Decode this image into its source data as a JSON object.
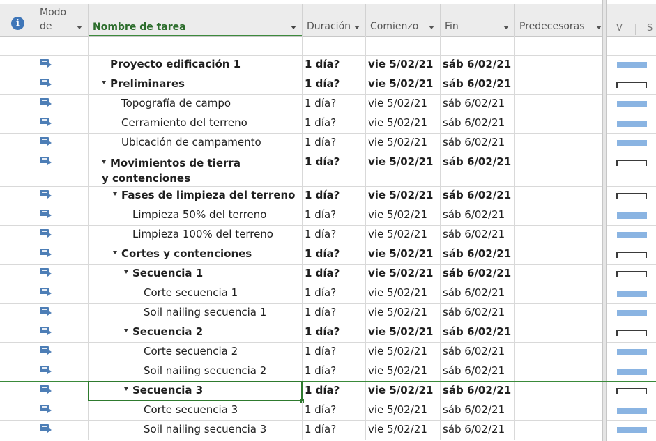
{
  "header": {
    "info": "i",
    "modo_line1": "Modo",
    "modo_line2": "de",
    "name": "Nombre de tarea",
    "duration": "Duración",
    "start": "Comienzo",
    "end": "Fin",
    "predecessors": "Predecesoras",
    "timescale_v": "V",
    "timescale_s": "S"
  },
  "tasks": [
    {
      "name": "Proyecto edificación 1",
      "duration": "1 día?",
      "start": "vie 5/02/21",
      "end": "sáb 6/02/21",
      "summary": false,
      "bold": true,
      "level": 0,
      "bar": "bar"
    },
    {
      "name": "Preliminares",
      "duration": "1 día?",
      "start": "vie 5/02/21",
      "end": "sáb 6/02/21",
      "summary": true,
      "bold": true,
      "level": 0,
      "bar": "summary"
    },
    {
      "name": "Topografía de campo",
      "duration": "1 día?",
      "start": "vie 5/02/21",
      "end": "sáb 6/02/21",
      "summary": false,
      "bold": false,
      "level": 1,
      "bar": "bar"
    },
    {
      "name": "Cerramiento del terreno",
      "duration": "1 día?",
      "start": "vie 5/02/21",
      "end": "sáb 6/02/21",
      "summary": false,
      "bold": false,
      "level": 1,
      "bar": "bar"
    },
    {
      "name": "Ubicación de campamento",
      "duration": "1 día?",
      "start": "vie 5/02/21",
      "end": "sáb 6/02/21",
      "summary": false,
      "bold": false,
      "level": 1,
      "bar": "bar"
    },
    {
      "name": "Movimientos de tierra y contenciones",
      "duration": "1 día?",
      "start": "vie 5/02/21",
      "end": "sáb 6/02/21",
      "summary": true,
      "bold": true,
      "level": 0,
      "bar": "summary",
      "tall": true
    },
    {
      "name": "Fases de limpieza del terreno",
      "duration": "1 día?",
      "start": "vie 5/02/21",
      "end": "sáb 6/02/21",
      "summary": true,
      "bold": true,
      "level": 1,
      "bar": "summary"
    },
    {
      "name": "Limpieza 50% del terreno",
      "duration": "1 día?",
      "start": "vie 5/02/21",
      "end": "sáb 6/02/21",
      "summary": false,
      "bold": false,
      "level": 2,
      "bar": "bar"
    },
    {
      "name": "Limpieza 100% del terreno",
      "duration": "1 día?",
      "start": "vie 5/02/21",
      "end": "sáb 6/02/21",
      "summary": false,
      "bold": false,
      "level": 2,
      "bar": "bar"
    },
    {
      "name": "Cortes y contenciones",
      "duration": "1 día?",
      "start": "vie 5/02/21",
      "end": "sáb 6/02/21",
      "summary": true,
      "bold": true,
      "level": 1,
      "bar": "summary"
    },
    {
      "name": "Secuencia 1",
      "duration": "1 día?",
      "start": "vie 5/02/21",
      "end": "sáb 6/02/21",
      "summary": true,
      "bold": true,
      "level": 2,
      "bar": "summary"
    },
    {
      "name": "Corte secuencia 1",
      "duration": "1 día?",
      "start": "vie 5/02/21",
      "end": "sáb 6/02/21",
      "summary": false,
      "bold": false,
      "level": 3,
      "bar": "bar"
    },
    {
      "name": "Soil nailing secuencia 1",
      "duration": "1 día?",
      "start": "vie 5/02/21",
      "end": "sáb 6/02/21",
      "summary": false,
      "bold": false,
      "level": 3,
      "bar": "bar"
    },
    {
      "name": "Secuencia 2",
      "duration": "1 día?",
      "start": "vie 5/02/21",
      "end": "sáb 6/02/21",
      "summary": true,
      "bold": true,
      "level": 2,
      "bar": "summary"
    },
    {
      "name": "Corte secuencia 2",
      "duration": "1 día?",
      "start": "vie 5/02/21",
      "end": "sáb 6/02/21",
      "summary": false,
      "bold": false,
      "level": 3,
      "bar": "bar"
    },
    {
      "name": "Soil nailing secuencia 2",
      "duration": "1 día?",
      "start": "vie 5/02/21",
      "end": "sáb 6/02/21",
      "summary": false,
      "bold": false,
      "level": 3,
      "bar": "bar"
    },
    {
      "name": "Secuencia 3",
      "duration": "1 día?",
      "start": "vie 5/02/21",
      "end": "sáb 6/02/21",
      "summary": true,
      "bold": true,
      "level": 2,
      "bar": "summary",
      "selected": true
    },
    {
      "name": "Corte secuencia 3",
      "duration": "1 día?",
      "start": "vie 5/02/21",
      "end": "sáb 6/02/21",
      "summary": false,
      "bold": false,
      "level": 3,
      "bar": "bar"
    },
    {
      "name": "Soil nailing secuencia 3",
      "duration": "1 día?",
      "start": "vie 5/02/21",
      "end": "sáb 6/02/21",
      "summary": false,
      "bold": false,
      "level": 3,
      "bar": "bar"
    }
  ]
}
